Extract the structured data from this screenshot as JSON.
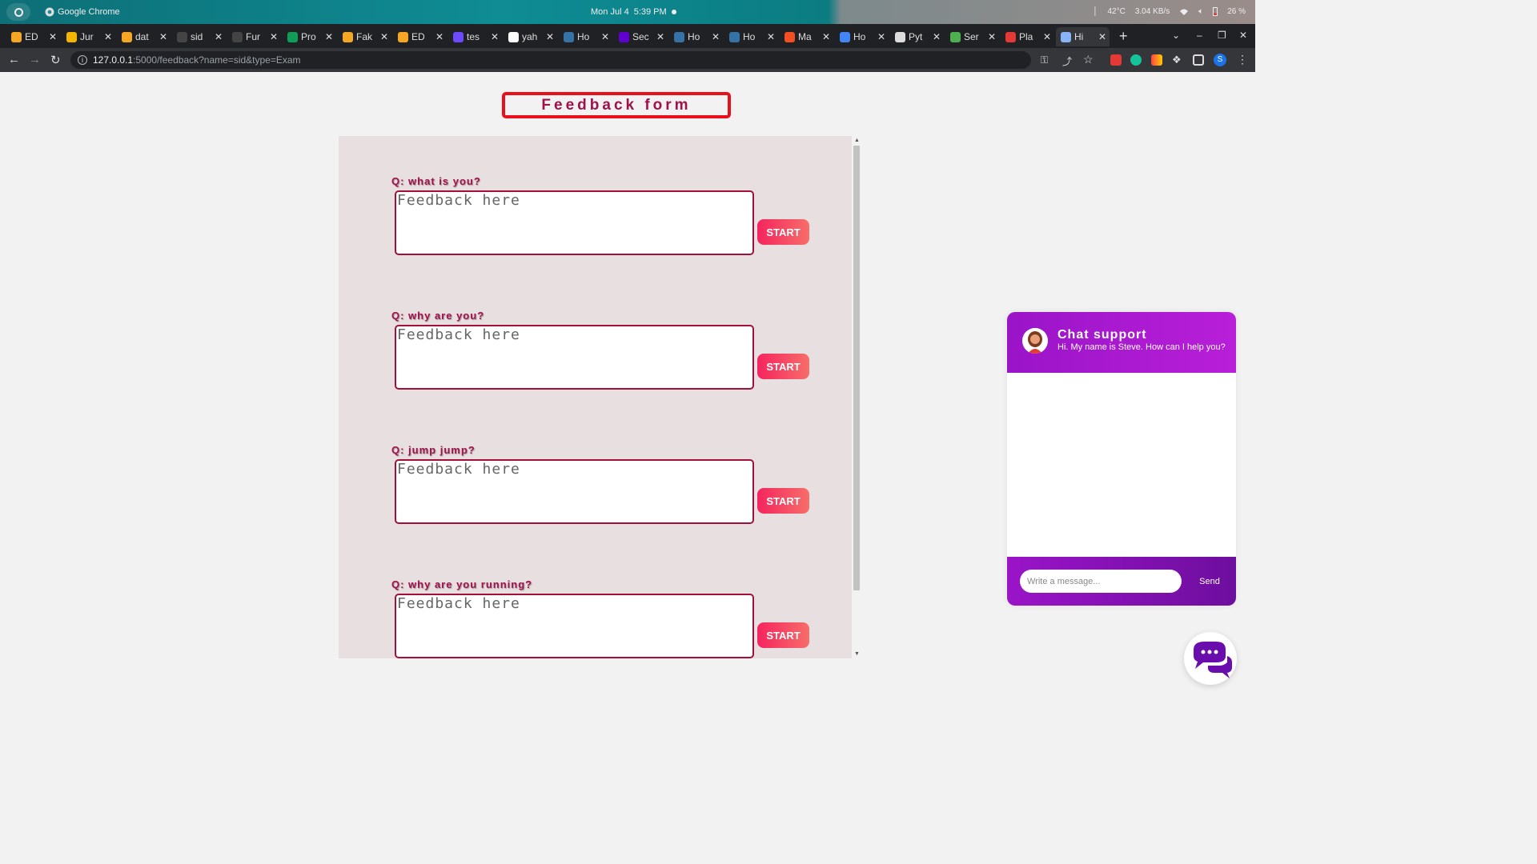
{
  "os": {
    "app_name": "Google Chrome",
    "date": "Mon Jul 4",
    "time": "5:39 PM",
    "temperature": "42°C",
    "network_speed": "3.04 KB/s",
    "battery": "26 %"
  },
  "browser": {
    "tabs": [
      {
        "label": "ED",
        "color": "#f5a623"
      },
      {
        "label": "Jur",
        "color": "#f4b400"
      },
      {
        "label": "dat",
        "color": "#f5a623"
      },
      {
        "label": "sid",
        "color": "#444444"
      },
      {
        "label": "Fur",
        "color": "#444444"
      },
      {
        "label": "Pro",
        "color": "#0f9d58"
      },
      {
        "label": "Fak",
        "color": "#f5a623"
      },
      {
        "label": "ED",
        "color": "#f5a623"
      },
      {
        "label": "tes",
        "color": "#6d4aff"
      },
      {
        "label": "yah",
        "color": "#ffffff"
      },
      {
        "label": "Ho",
        "color": "#3572a5"
      },
      {
        "label": "Sec",
        "color": "#6001d2"
      },
      {
        "label": "Ho",
        "color": "#3572a5"
      },
      {
        "label": "Ho",
        "color": "#3572a5"
      },
      {
        "label": "Ma",
        "color": "#f25022"
      },
      {
        "label": "Ho",
        "color": "#4285f4"
      },
      {
        "label": "Pyt",
        "color": "#dddddd"
      },
      {
        "label": "Ser",
        "color": "#4caf50"
      },
      {
        "label": "Pla",
        "color": "#e53935"
      },
      {
        "label": "Hi",
        "color": "#8ab4f8"
      }
    ],
    "active_tab_index": 19,
    "url_host": "127.0.0.1",
    "url_rest": ":5000/feedback?name=sid&type=Exam",
    "profile_initial": "S"
  },
  "page": {
    "title": "Feedback form",
    "textarea_placeholder": "Feedback here",
    "start_label": "START",
    "questions": [
      {
        "text": "Q: what is you?"
      },
      {
        "text": "Q: why are you?"
      },
      {
        "text": "Q: jump jump?"
      },
      {
        "text": "Q: why are you running?"
      }
    ]
  },
  "chat": {
    "title": "Chat support",
    "subtitle": "Hi. My name is Steve. How can I help you?",
    "input_placeholder": "Write a message...",
    "send_label": "Send"
  },
  "colors": {
    "accent": "#a0104a",
    "title_border": "#e8101a",
    "chat_purple": "#9a14c8",
    "start_gradient_from": "#f5245e",
    "start_gradient_to": "#f76e6a"
  }
}
